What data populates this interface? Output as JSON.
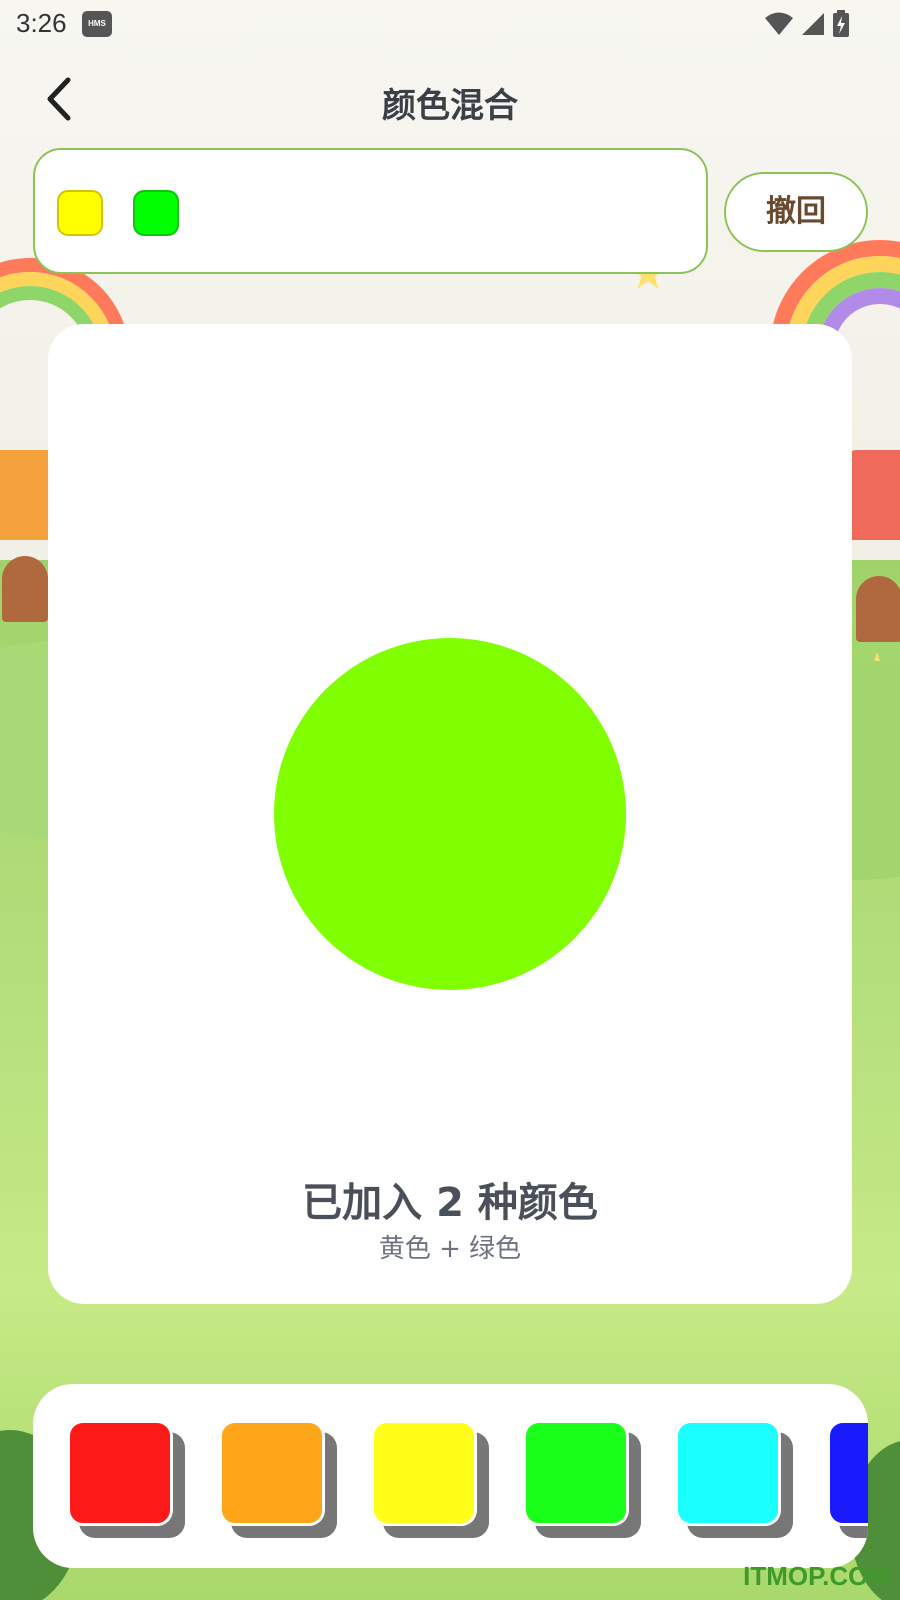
{
  "status_bar": {
    "time": "3:26",
    "hms_badge": "HMS",
    "icons": [
      "wifi-icon",
      "signal-icon",
      "battery-charging-icon"
    ]
  },
  "header": {
    "title": "颜色混合",
    "back_icon": "chevron-left-icon"
  },
  "sequence": {
    "chips": [
      {
        "name": "yellow",
        "color": "#ffff00"
      },
      {
        "name": "green",
        "color": "#00ff00"
      }
    ],
    "arrow": "→"
  },
  "undo_button": {
    "label": "撤回"
  },
  "mix_result": {
    "color": "#80ff00",
    "count_text": "已加入 2 种颜色",
    "formula_text": "黄色 + 绿色"
  },
  "palette": {
    "swatches": [
      {
        "name": "red",
        "color": "#ff1a1a"
      },
      {
        "name": "orange",
        "color": "#ffa51a"
      },
      {
        "name": "yellow",
        "color": "#ffff1a"
      },
      {
        "name": "green",
        "color": "#1aff1a"
      },
      {
        "name": "cyan",
        "color": "#1affff"
      },
      {
        "name": "blue",
        "color": "#1a1aff"
      }
    ]
  },
  "watermark": "ITMOP.COM"
}
